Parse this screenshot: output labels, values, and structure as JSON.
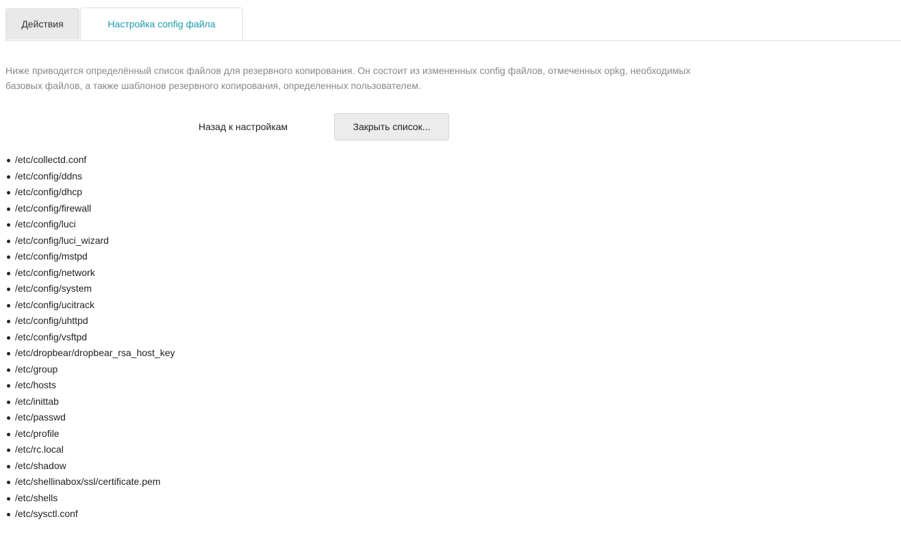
{
  "tabs": [
    {
      "label": "Действия",
      "active": false
    },
    {
      "label": "Настройка config файла",
      "active": true
    }
  ],
  "description": {
    "line1": "Ниже приводится определённый список файлов для резервного копирования. Он состоит из измененных config файлов, отмеченных opkg, необходимых",
    "line2": "базовых файлов, а также шаблонов резервного копирования, определенных пользователем."
  },
  "actions": {
    "back_label": "Назад к настройкам",
    "close_label": "Закрыть список..."
  },
  "files": [
    "/etc/collectd.conf",
    "/etc/config/ddns",
    "/etc/config/dhcp",
    "/etc/config/firewall",
    "/etc/config/luci",
    "/etc/config/luci_wizard",
    "/etc/config/mstpd",
    "/etc/config/network",
    "/etc/config/system",
    "/etc/config/ucitrack",
    "/etc/config/uhttpd",
    "/etc/config/vsftpd",
    "/etc/dropbear/dropbear_rsa_host_key",
    "/etc/group",
    "/etc/hosts",
    "/etc/inittab",
    "/etc/passwd",
    "/etc/profile",
    "/etc/rc.local",
    "/etc/shadow",
    "/etc/shellinabox/ssl/certificate.pem",
    "/etc/shells",
    "/etc/sysctl.conf"
  ],
  "colors": {
    "accent": "#1b9aaa",
    "description_text": "#888888",
    "tab_inactive_bg": "#e9e9e9",
    "button_bg": "#ececec"
  }
}
